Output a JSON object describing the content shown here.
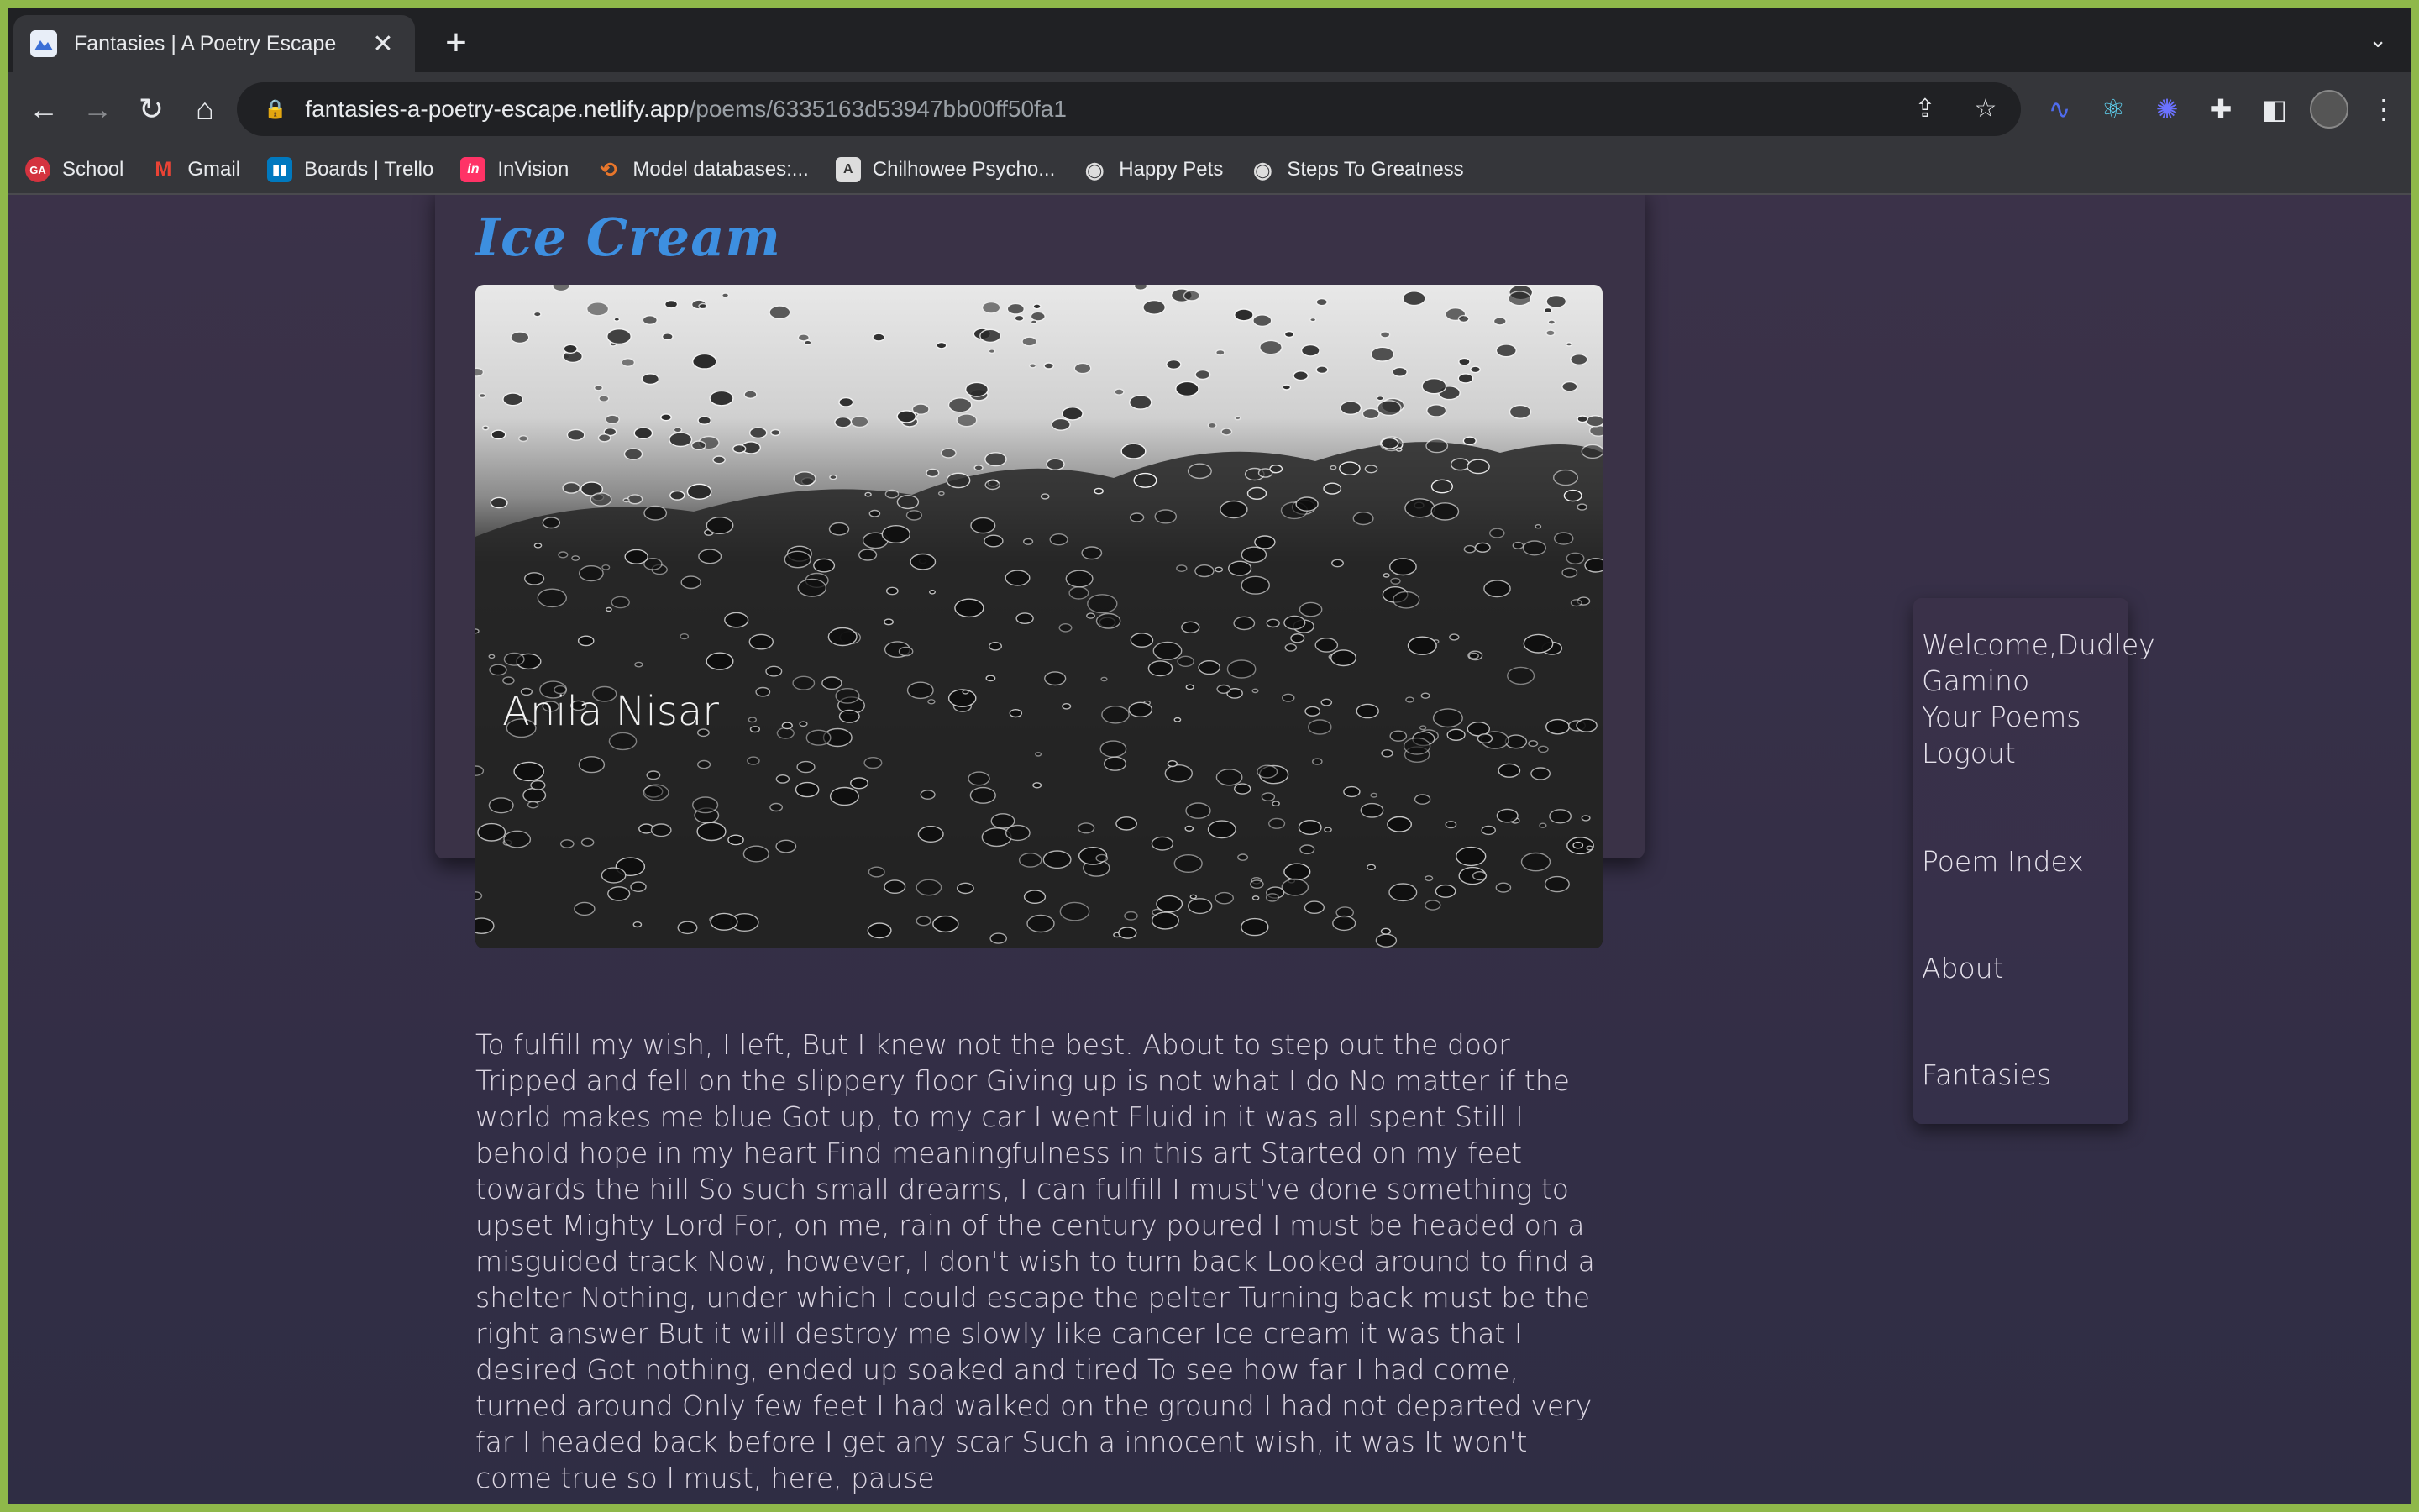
{
  "browser": {
    "tab_title": "Fantasies | A Poetry Escape",
    "new_tab_symbol": "+",
    "url_host": "fantasies-a-poetry-escape.netlify.app",
    "url_path": "/poems/6335163d53947bb00ff50fa1",
    "bookmarks": [
      {
        "label": "School",
        "icon": "school-icon",
        "color": "#d4333f",
        "glyph": "GA"
      },
      {
        "label": "Gmail",
        "icon": "gmail-icon",
        "color": "#ffffff",
        "glyph": "M"
      },
      {
        "label": "Boards | Trello",
        "icon": "trello-icon",
        "color": "#0079bf",
        "glyph": "T"
      },
      {
        "label": "InVision",
        "icon": "invision-icon",
        "color": "#ff3366",
        "glyph": "in"
      },
      {
        "label": "Model databases:...",
        "icon": "model-db-icon",
        "color": "#e8762b",
        "glyph": "⟲"
      },
      {
        "label": "Chilhowee Psycho...",
        "icon": "chilhowee-icon",
        "color": "#dddddd",
        "glyph": "A"
      },
      {
        "label": "Happy Pets",
        "icon": "globe-icon",
        "color": "#dddddd",
        "glyph": "🌐"
      },
      {
        "label": "Steps To Greatness",
        "icon": "globe-icon",
        "color": "#dddddd",
        "glyph": "🌐"
      }
    ]
  },
  "poem": {
    "title": "Ice Cream",
    "author": "Anila Nisar",
    "body": "To fulfill my wish, I left, But I knew not the best. About to step out the door Tripped and fell on the slippery floor Giving up is not what I do No matter if the world makes me blue Got up, to my car I went Fluid in it was all spent Still I behold hope in my heart Find meaningfulness in this art Started on my feet towards the hill So such small dreams, I can fulfill I must've done something to upset Mighty Lord For, on me, rain of the century poured I must be headed on a misguided track Now, however, I don't wish to turn back Looked around to find a shelter Nothing, under which I could escape the pelter Turning back must be the right answer But it will destroy me slowly like cancer Ice cream it was that I desired Got nothing, ended up soaked and tired To see how far I had come, turned around Only few feet I had walked on the ground I had not departed very far I headed back before I get any scar Such a innocent wish, it was It won't come true so I must, here, pause"
  },
  "nav": {
    "welcome": "Welcome,Dudley Gamino",
    "your_poems": "Your Poems",
    "logout": "Logout",
    "poem_index": "Poem Index",
    "about": "About",
    "fantasies": "Fantasies"
  },
  "colors": {
    "title_accent": "#3d8fe0",
    "page_bg": "#352f47"
  }
}
